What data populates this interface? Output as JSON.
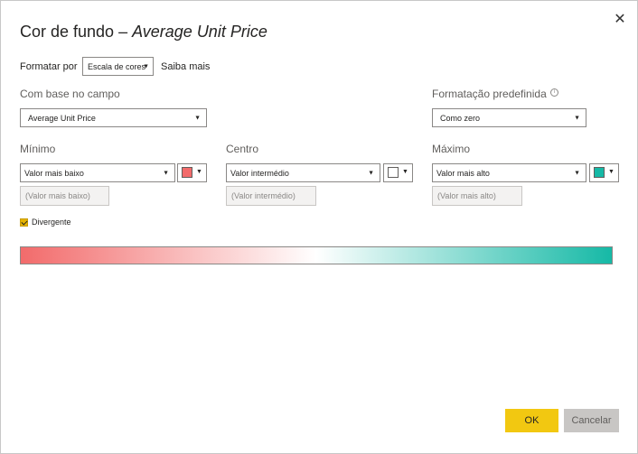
{
  "dialog": {
    "title_prefix": "Cor de fundo – ",
    "title_field": "Average Unit Price",
    "close_symbol": "✕"
  },
  "format_by": {
    "label": "Formatar por",
    "value": "Escala de cores",
    "learn_more": "Saiba mais"
  },
  "based_on": {
    "label": "Com base no campo",
    "value": "Average Unit Price"
  },
  "default_format": {
    "label": "Formatação predefinida",
    "value": "Como zero",
    "info_icon": "info-icon"
  },
  "minimum": {
    "label": "Mínimo",
    "value": "Valor mais baixo",
    "placeholder": "(Valor mais baixo)",
    "color": "#f26b6b"
  },
  "center": {
    "label": "Centro",
    "value": "Valor intermédio",
    "placeholder": "(Valor intermédio)",
    "color": "#ffffff"
  },
  "maximum": {
    "label": "Máximo",
    "value": "Valor mais alto",
    "placeholder": "(Valor mais alto)",
    "color": "#16b9a6"
  },
  "diverging": {
    "label": "Divergente",
    "checked": true
  },
  "buttons": {
    "ok": "OK",
    "cancel": "Cancelar"
  },
  "colors": {
    "accent": "#f2c811",
    "border": "#8a8886"
  }
}
